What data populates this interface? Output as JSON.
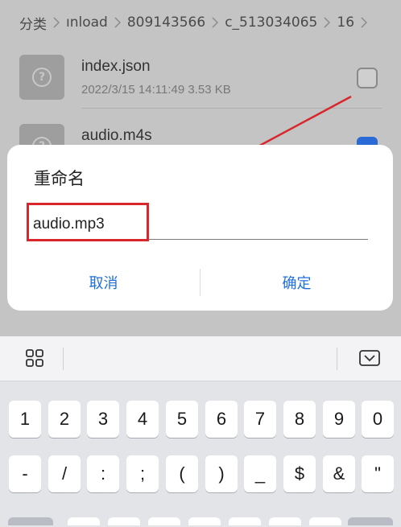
{
  "breadcrumb": [
    "分类",
    "ınload",
    "809143566",
    "c_513034065",
    "16"
  ],
  "files": [
    {
      "name": "index.json",
      "meta": "2022/3/15 14:11:49 3.53 KB",
      "checked": false
    },
    {
      "name": "audio.m4s",
      "meta": "",
      "checked": true
    }
  ],
  "dialog": {
    "title": "重命名",
    "input_value": "audio.mp3",
    "cancel_label": "取消",
    "confirm_label": "确定"
  },
  "keyboard": {
    "numbers": [
      "1",
      "2",
      "3",
      "4",
      "5",
      "6",
      "7",
      "8",
      "9",
      "0"
    ],
    "symbols": [
      "-",
      "/",
      ":",
      ";",
      "(",
      ")",
      "_",
      "$",
      "&",
      "\""
    ],
    "icons": {
      "menu": "grid-icon",
      "collapse": "keyboard-collapse-icon"
    }
  },
  "colors": {
    "accent": "#1e6fd9",
    "annotation": "#d8262c",
    "checkbox_checked": "#2a6ad6"
  }
}
